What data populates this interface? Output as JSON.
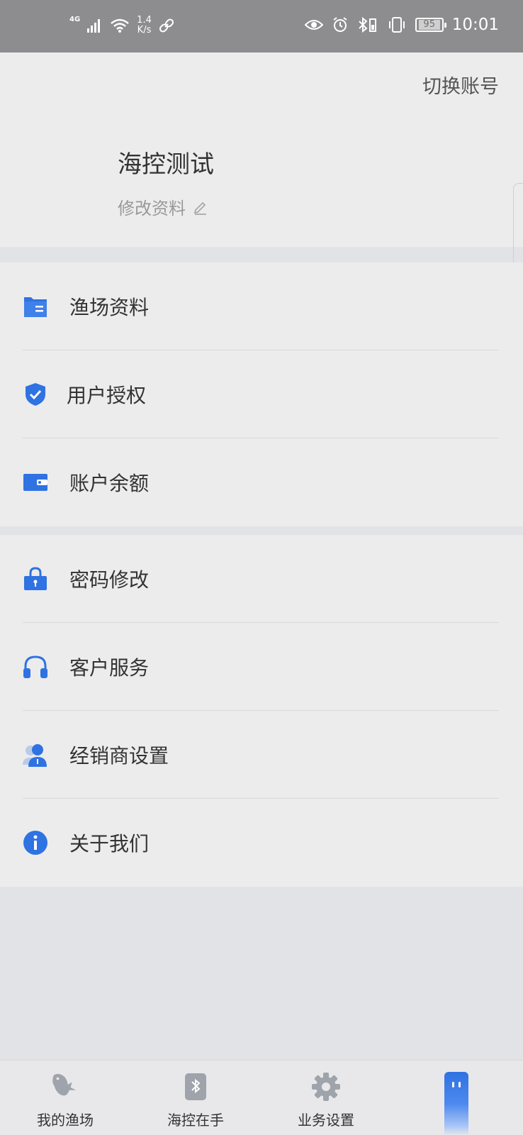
{
  "status_bar": {
    "network_type": "4G",
    "speed_value": "1.4",
    "speed_unit": "K/s",
    "battery": "95",
    "time": "10:01"
  },
  "header": {
    "switch_account": "切换账号",
    "profile_name": "海控测试",
    "edit_profile": "修改资料"
  },
  "menu_group_1": [
    {
      "label": "渔场资料",
      "icon": "folder-icon"
    },
    {
      "label": "用户授权",
      "icon": "shield-check-icon"
    },
    {
      "label": "账户余额",
      "icon": "wallet-icon"
    }
  ],
  "menu_group_2": [
    {
      "label": "密码修改",
      "icon": "lock-icon"
    },
    {
      "label": "客户服务",
      "icon": "headset-icon"
    },
    {
      "label": "经销商设置",
      "icon": "dealer-icon"
    },
    {
      "label": "关于我们",
      "icon": "info-icon"
    }
  ],
  "tabs": [
    {
      "label": "我的渔场",
      "icon": "fish-icon"
    },
    {
      "label": "海控在手",
      "icon": "bluetooth-phone-icon"
    },
    {
      "label": "业务设置",
      "icon": "gear-icon"
    },
    {
      "label": "",
      "icon": "profile-tab-icon"
    }
  ],
  "colors": {
    "accent": "#2f72e2",
    "status_bar": "#8d8d8f",
    "tab_icon_gray": "#9fa3ab"
  }
}
